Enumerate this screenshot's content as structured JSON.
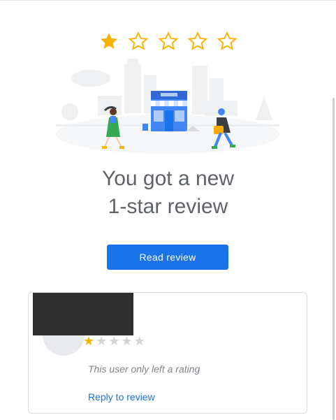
{
  "header": {
    "rating": 1,
    "max_rating": 5,
    "star_color": "#f9b203"
  },
  "headline": {
    "line1": "You got a new",
    "line2": "1-star review"
  },
  "primary_action": {
    "label": "Read review",
    "color": "#1a73e8"
  },
  "review_card": {
    "rating": 1,
    "max_rating": 5,
    "note": "This user only left a rating",
    "reply_label": "Reply to review"
  }
}
